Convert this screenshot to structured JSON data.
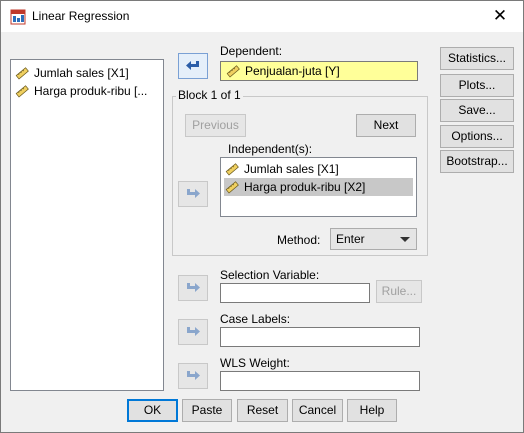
{
  "window": {
    "title": "Linear Regression",
    "close_glyph": "✕"
  },
  "source_list": {
    "items": [
      {
        "label": "Jumlah sales [X1]",
        "icon": "scale-ruler-icon"
      },
      {
        "label": "Harga produk-ribu [...",
        "icon": "scale-ruler-icon"
      }
    ]
  },
  "dependent": {
    "label": "Dependent:",
    "value": "Penjualan-juta [Y]"
  },
  "block": {
    "title": "Block 1 of 1",
    "previous": "Previous",
    "next": "Next",
    "independents_label": "Independent(s):",
    "independents": [
      {
        "label": "Jumlah sales [X1]",
        "selected": false
      },
      {
        "label": "Harga produk-ribu [X2]",
        "selected": true
      }
    ],
    "method_label": "Method:",
    "method_value": "Enter"
  },
  "selection_variable": {
    "label": "Selection Variable:",
    "value": "",
    "rule": "Rule..."
  },
  "case_labels": {
    "label": "Case Labels:",
    "value": ""
  },
  "wls_weight": {
    "label": "WLS Weight:",
    "value": ""
  },
  "side_buttons": {
    "statistics": "Statistics...",
    "plots": "Plots...",
    "save": "Save...",
    "options": "Options...",
    "bootstrap": "Bootstrap..."
  },
  "bottom_buttons": {
    "ok": "OK",
    "paste": "Paste",
    "reset": "Reset",
    "cancel": "Cancel",
    "help": "Help"
  },
  "colors": {
    "accent": "#0078d7",
    "dependent_bg": "#ffff99",
    "selected_row": "#c8c8c8"
  }
}
